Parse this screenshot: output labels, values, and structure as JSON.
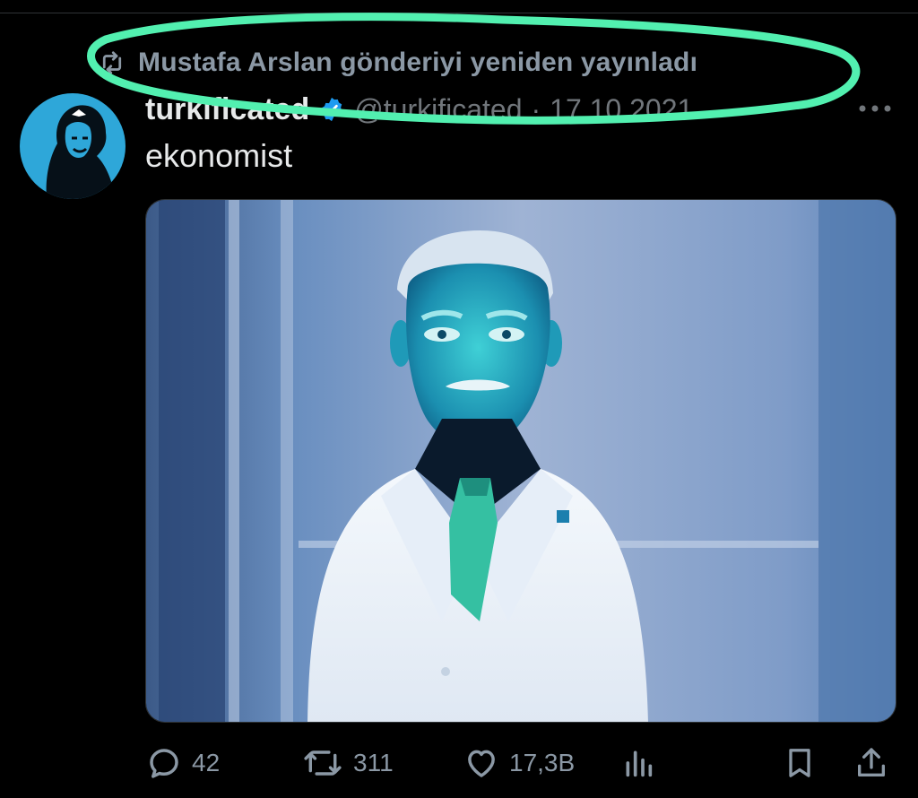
{
  "repost": {
    "icon": "repost-icon",
    "text": "Mustafa Arslan gönderiyi yeniden yayınladı"
  },
  "author": {
    "display_name": "turkificated",
    "verified_icon": "verified-badge-icon",
    "handle": "@turkificated",
    "separator": "·",
    "date": "17.10.2021"
  },
  "tweet": {
    "text": "ekonomist"
  },
  "actions": {
    "replies": "42",
    "reposts": "311",
    "likes": "17,3B"
  },
  "colors": {
    "background": "#000000",
    "highlight_marker": "#52f0b0",
    "verified": "#1d9bf0",
    "muted_text": "#71767b"
  }
}
